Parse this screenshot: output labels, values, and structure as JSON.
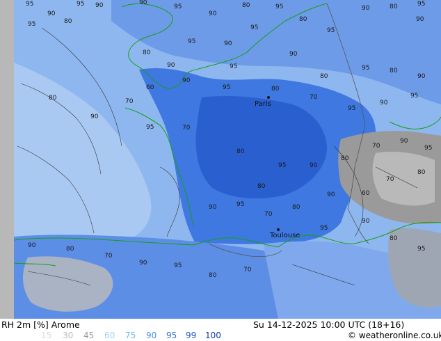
{
  "map": {
    "city_label": "Paris",
    "city_label_2": "Toulouse",
    "contour_values": [
      "95",
      "90",
      "95",
      "90",
      "95",
      "80",
      "90",
      "95",
      "90",
      "80",
      "95",
      "80",
      "95",
      "90",
      "80",
      "95",
      "90",
      "95",
      "90",
      "95",
      "80",
      "90",
      "95",
      "90",
      "80",
      "95",
      "80",
      "90",
      "95",
      "90",
      "95",
      "70",
      "80",
      "95",
      "90",
      "60",
      "70",
      "80",
      "90",
      "95",
      "70",
      "80",
      "95",
      "90",
      "80",
      "70",
      "90",
      "95",
      "80",
      "70",
      "60",
      "90",
      "80",
      "70",
      "95",
      "90",
      "80",
      "95",
      "90",
      "80",
      "95",
      "90",
      "80",
      "70",
      "90",
      "95",
      "80",
      "70"
    ]
  },
  "footer": {
    "title": "RH 2m [%] Arome",
    "datetime": "Su 14-12-2025 10:00 UTC (18+16)",
    "credit": "© weatheronline.co.uk"
  },
  "legend": {
    "items": [
      {
        "label": "15",
        "color": "#dcdcdc"
      },
      {
        "label": "30",
        "color": "#b9b9b9"
      },
      {
        "label": "45",
        "color": "#9a9a9a"
      },
      {
        "label": "60",
        "color": "#9fd3f5"
      },
      {
        "label": "75",
        "color": "#6ab8ef"
      },
      {
        "label": "90",
        "color": "#4a8fe0"
      },
      {
        "label": "95",
        "color": "#2f6ed8"
      },
      {
        "label": "99",
        "color": "#1c52c4"
      },
      {
        "label": "100",
        "color": "#0c37a8"
      }
    ]
  }
}
